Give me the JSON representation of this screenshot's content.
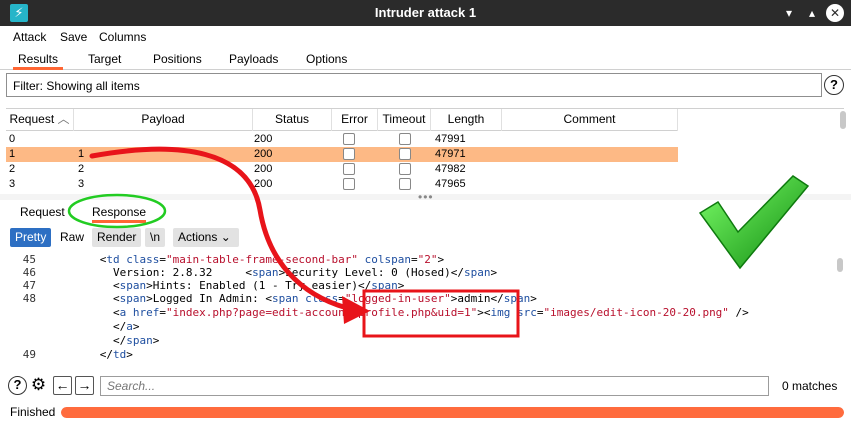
{
  "window": {
    "title": "Intruder attack 1",
    "app_icon": "⚡"
  },
  "menu": {
    "items": [
      "Attack",
      "Save",
      "Columns"
    ]
  },
  "tabs": {
    "items": [
      "Results",
      "Target",
      "Positions",
      "Payloads",
      "Options"
    ],
    "active": "Results"
  },
  "filter": {
    "text": "Filter: Showing all items",
    "help": "?"
  },
  "results_table": {
    "columns": [
      "Request",
      "Payload",
      "Status",
      "Error",
      "Timeout",
      "Length",
      "Comment"
    ],
    "sort_indicator": "up-chevron-icon",
    "rows": [
      {
        "request": "0",
        "payload": "",
        "status": "200",
        "error": false,
        "timeout": false,
        "length": "47991",
        "comment": "",
        "selected": false
      },
      {
        "request": "1",
        "payload": "1",
        "status": "200",
        "error": false,
        "timeout": false,
        "length": "47971",
        "comment": "",
        "selected": true
      },
      {
        "request": "2",
        "payload": "2",
        "status": "200",
        "error": false,
        "timeout": false,
        "length": "47982",
        "comment": "",
        "selected": false
      },
      {
        "request": "3",
        "payload": "3",
        "status": "200",
        "error": false,
        "timeout": false,
        "length": "47965",
        "comment": "",
        "selected": false
      }
    ],
    "selected_color": "#fdb985"
  },
  "detail_tabs": {
    "items": [
      "Request",
      "Response"
    ],
    "active": "Response"
  },
  "view_toolbar": {
    "pretty": "Pretty",
    "raw": "Raw",
    "render": "Render",
    "newline": "\\n",
    "actions": "Actions"
  },
  "code_lines": [
    {
      "num": "45",
      "parts": [
        [
          "txt",
          "      <"
        ],
        [
          "tag",
          "td"
        ],
        [
          "txt",
          " "
        ],
        [
          "attr",
          "class"
        ],
        [
          "txt",
          "="
        ],
        [
          "str",
          "\"main-table-frame-second-bar\""
        ],
        [
          "txt",
          " "
        ],
        [
          "attr",
          "colspan"
        ],
        [
          "txt",
          "="
        ],
        [
          "str",
          "\"2\""
        ],
        [
          "txt",
          ">"
        ]
      ]
    },
    {
      "num": "46",
      "parts": [
        [
          "txt",
          "        Version: 2.8.32     <"
        ],
        [
          "tag",
          "span"
        ],
        [
          "txt",
          ">Security Level: 0 (Hosed)</"
        ],
        [
          "tag",
          "span"
        ],
        [
          "txt",
          ">"
        ]
      ]
    },
    {
      "num": "47",
      "parts": [
        [
          "txt",
          "        <"
        ],
        [
          "tag",
          "span"
        ],
        [
          "txt",
          ">Hints: Enabled (1 - Try easier)</"
        ],
        [
          "tag",
          "span"
        ],
        [
          "txt",
          ">"
        ]
      ]
    },
    {
      "num": "48",
      "parts": [
        [
          "txt",
          "        <"
        ],
        [
          "tag",
          "span"
        ],
        [
          "txt",
          ">Logged In Admin: <"
        ],
        [
          "tag",
          "span"
        ],
        [
          "txt",
          " "
        ],
        [
          "attr",
          "class"
        ],
        [
          "txt",
          "="
        ],
        [
          "str",
          "\"logged-in-user\""
        ],
        [
          "txt",
          ">admin</"
        ],
        [
          "tag",
          "span"
        ],
        [
          "txt",
          ">"
        ]
      ]
    },
    {
      "num": "",
      "parts": [
        [
          "txt",
          "        <"
        ],
        [
          "tag",
          "a"
        ],
        [
          "txt",
          " "
        ],
        [
          "attr",
          "href"
        ],
        [
          "txt",
          "="
        ],
        [
          "str",
          "\"index.php?page=edit-account-profile.php&uid=1\""
        ],
        [
          "txt",
          "><"
        ],
        [
          "tag",
          "img"
        ],
        [
          "txt",
          " "
        ],
        [
          "attr",
          "src"
        ],
        [
          "txt",
          "="
        ],
        [
          "str",
          "\"images/edit-icon-20-20.png\""
        ],
        [
          "txt",
          " />"
        ]
      ]
    },
    {
      "num": "",
      "parts": [
        [
          "txt",
          "        </"
        ],
        [
          "tag",
          "a"
        ],
        [
          "txt",
          ">"
        ]
      ]
    },
    {
      "num": "",
      "parts": [
        [
          "txt",
          "        </"
        ],
        [
          "tag",
          "span"
        ],
        [
          "txt",
          ">"
        ]
      ]
    },
    {
      "num": "49",
      "parts": [
        [
          "txt",
          "      </"
        ],
        [
          "tag",
          "td"
        ],
        [
          "txt",
          ">"
        ]
      ]
    }
  ],
  "search": {
    "placeholder": "Search...",
    "matches": "0 matches"
  },
  "status": {
    "label": "Finished",
    "progress": 1.0
  },
  "colors": {
    "accent": "#ff6633",
    "annotation_red": "#e8141a",
    "annotation_green": "#22cc22",
    "selected_tab_blue": "#2d6fc3"
  }
}
